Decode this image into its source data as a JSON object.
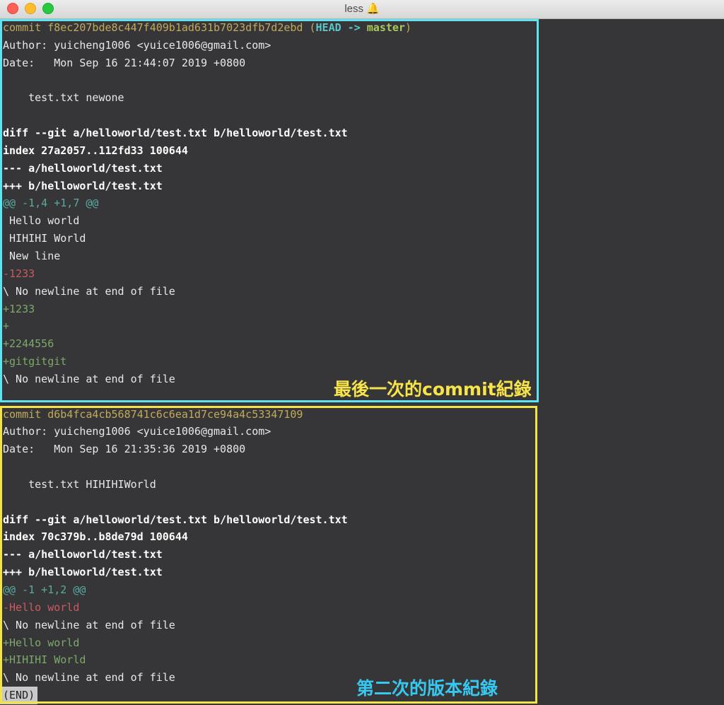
{
  "window": {
    "title": "less",
    "bell_icon": "bell-icon"
  },
  "annotations": {
    "latest": "最後一次的commit紀錄",
    "second": "第二次的版本紀錄"
  },
  "commit1": {
    "label": "commit ",
    "hash": "f8ec207bde8c447f409b1ad631b7023dfb7d2ebd",
    "ref_open": " (",
    "head": "HEAD -> ",
    "branch": "master",
    "ref_close": ")",
    "author": "Author: yuicheng1006 <yuice1006@gmail.com>",
    "date": "Date:   Mon Sep 16 21:44:07 2019 +0800",
    "message": "    test.txt newone",
    "diff_header": "diff --git a/helloworld/test.txt b/helloworld/test.txt",
    "index": "index 27a2057..112fd33 100644",
    "minus_file": "--- a/helloworld/test.txt",
    "plus_file": "+++ b/helloworld/test.txt",
    "hunk": "@@ -1,4 +1,7 @@",
    "ctx1": " Hello world",
    "ctx2": " HIHIHI World",
    "ctx3": " New line",
    "del1": "-1233",
    "nonl1": "\\ No newline at end of file",
    "add1": "+1233",
    "add2": "+",
    "add3": "+2244556",
    "add4": "+gitgitgit",
    "nonl2": "\\ No newline at end of file"
  },
  "commit2": {
    "label": "commit ",
    "hash": "d6b4fca4cb568741c6c6ea1d7ce94a4c53347109",
    "author": "Author: yuicheng1006 <yuice1006@gmail.com>",
    "date": "Date:   Mon Sep 16 21:35:36 2019 +0800",
    "message": "    test.txt HIHIHIWorld",
    "diff_header": "diff --git a/helloworld/test.txt b/helloworld/test.txt",
    "index": "index 70c379b..b8de79d 100644",
    "minus_file": "--- a/helloworld/test.txt",
    "plus_file": "+++ b/helloworld/test.txt",
    "hunk": "@@ -1 +1,2 @@",
    "del1": "-Hello world",
    "nonl1": "\\ No newline at end of file",
    "add1": "+Hello world",
    "add2": "+HIHIHI World",
    "nonl2": "\\ No newline at end of file"
  },
  "pager": {
    "end": "(END)"
  }
}
